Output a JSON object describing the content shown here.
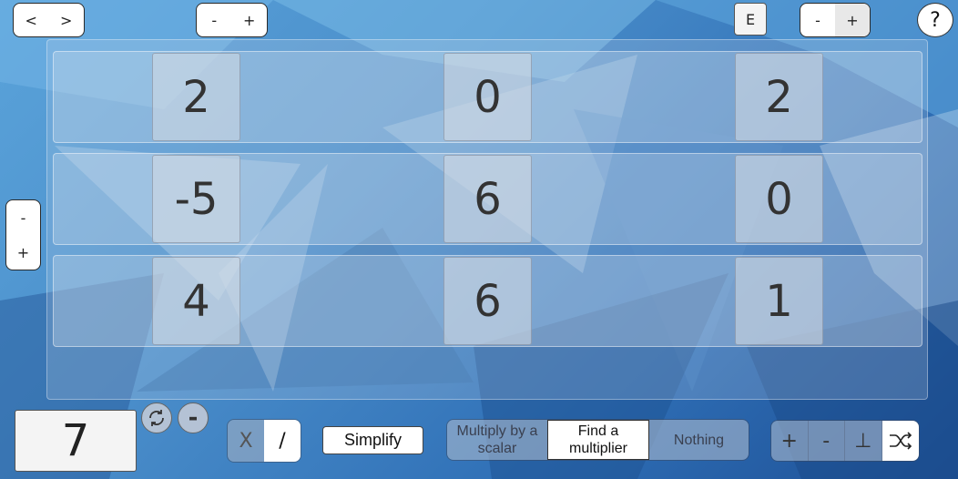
{
  "nav": {
    "prev_label": "<",
    "next_label": ">"
  },
  "column_stepper": {
    "minus_label": "-",
    "plus_label": "+"
  },
  "e_button_label": "E",
  "zoom_stepper": {
    "minus_label": "-",
    "plus_label": "+"
  },
  "help_label": "?",
  "row_stepper": {
    "minus_label": "-",
    "plus_label": "+"
  },
  "matrix": {
    "rows": [
      [
        "2",
        "0",
        "2"
      ],
      [
        "-5",
        "6",
        "0"
      ],
      [
        "4",
        "6",
        "1"
      ]
    ]
  },
  "scalar": {
    "value": "7",
    "negate_label": "-"
  },
  "operation": {
    "multiply_label": "X",
    "divide_label": "/"
  },
  "simplify_label": "Simplify",
  "mode": {
    "options": [
      "Multiply by a scalar",
      "Find a multiplier",
      "Nothing"
    ],
    "selected": "Find a multiplier"
  },
  "tools": {
    "add_label": "+",
    "subtract_label": "-",
    "perpendicular_label": "⊥"
  },
  "icons": [
    "refresh-icon",
    "shuffle-icon"
  ]
}
